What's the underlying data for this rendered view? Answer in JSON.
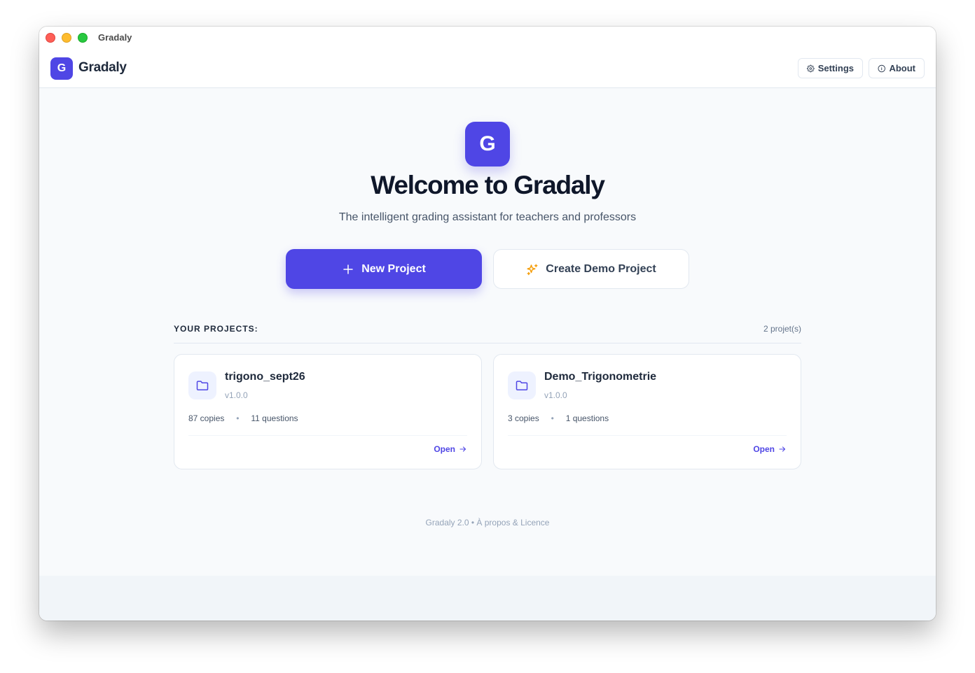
{
  "window": {
    "title": "Gradaly"
  },
  "header": {
    "logo_letter": "G",
    "app_name": "Gradaly",
    "settings_label": "Settings",
    "about_label": "About"
  },
  "hero": {
    "logo_letter": "G",
    "title": "Welcome to Gradaly",
    "subtitle": "The intelligent grading assistant for teachers and professors",
    "new_project_label": "New Project",
    "demo_project_label": "Create Demo Project"
  },
  "projects": {
    "heading": "YOUR PROJECTS:",
    "count": "2 projet(s)",
    "items": [
      {
        "name": "trigono_sept26",
        "version": "v1.0.0",
        "copies": "87 copies",
        "questions": "11 questions",
        "open_label": "Open"
      },
      {
        "name": "Demo_Trigonometrie",
        "version": "v1.0.0",
        "copies": "3 copies",
        "questions": "1 questions",
        "open_label": "Open"
      }
    ]
  },
  "footer": {
    "text": "Gradaly 2.0 • À propos & Licence"
  },
  "colors": {
    "accent": "#4f46e5",
    "demo_icon": "#f59e0b"
  },
  "icons": {
    "settings": "gear-icon",
    "about": "info-icon",
    "new": "plus-icon",
    "demo": "sparkles-icon",
    "project": "folder-icon",
    "open": "arrow-right-icon"
  }
}
